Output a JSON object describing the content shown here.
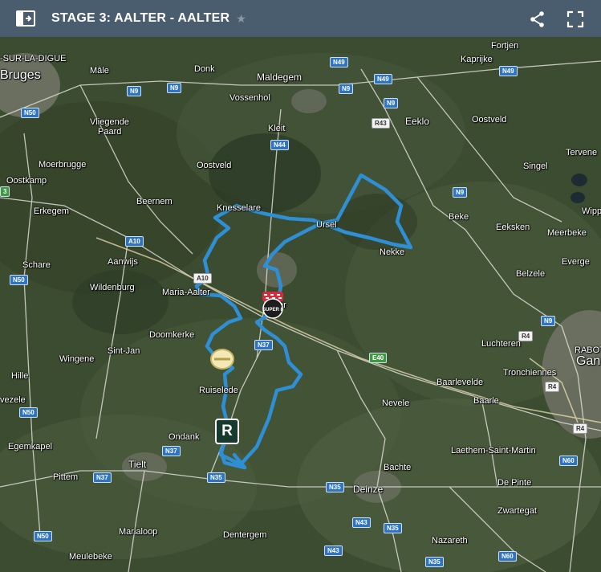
{
  "header": {
    "title": "STAGE 3: AALTER - AALTER",
    "star_icon": "star-icon",
    "share_icon": "share-icon",
    "fullscreen_icon": "fullscreen-icon",
    "panel_icon": "sidebar-toggle-icon",
    "background": "#4a5d6e"
  },
  "map": {
    "route_color": "#2f8fd4",
    "markers": {
      "start_finish_label": "R",
      "sprint_label": "SUPER 8"
    },
    "places": [
      {
        "id": "sur-la-digue",
        "name": "-SUR-LA-DIGUE"
      },
      {
        "id": "bruges",
        "name": "Bruges"
      },
      {
        "id": "male",
        "name": "Mâle"
      },
      {
        "id": "donk",
        "name": "Donk"
      },
      {
        "id": "maldegem",
        "name": "Maldegem"
      },
      {
        "id": "fortjen",
        "name": "Fortjen"
      },
      {
        "id": "kaprijke",
        "name": "Kaprijke"
      },
      {
        "id": "vossenhol",
        "name": "Vossenhol"
      },
      {
        "id": "vliegende-paard",
        "name": "Vliegende"
      },
      {
        "id": "vliegende-paard-2",
        "name": "Paard"
      },
      {
        "id": "kleit",
        "name": "Kleit"
      },
      {
        "id": "eeklo",
        "name": "Eeklo"
      },
      {
        "id": "oostveld-e",
        "name": "Oostveld"
      },
      {
        "id": "moerbrugge",
        "name": "Moerbrugge"
      },
      {
        "id": "oostveld-w",
        "name": "Oostveld"
      },
      {
        "id": "tervenen",
        "name": "Tervene"
      },
      {
        "id": "oostkamp",
        "name": "Oostkamp"
      },
      {
        "id": "singel",
        "name": "Singel"
      },
      {
        "id": "beernem",
        "name": "Beernem"
      },
      {
        "id": "knesselare",
        "name": "Knesselare"
      },
      {
        "id": "erkegem",
        "name": "Erkegem"
      },
      {
        "id": "ursel",
        "name": "Ursel"
      },
      {
        "id": "beke",
        "name": "Beke"
      },
      {
        "id": "wippelgem",
        "name": "Wipp"
      },
      {
        "id": "eeksken",
        "name": "Eeksken"
      },
      {
        "id": "meerbeke",
        "name": "Meerbeke"
      },
      {
        "id": "schare",
        "name": "Schare"
      },
      {
        "id": "aanwijs",
        "name": "Aanwijs"
      },
      {
        "id": "nekke",
        "name": "Nekke"
      },
      {
        "id": "evergem",
        "name": "Everge"
      },
      {
        "id": "belzele",
        "name": "Belzele"
      },
      {
        "id": "maria-aalter",
        "name": "Maria-Aalter"
      },
      {
        "id": "aalter",
        "name": "Aalter"
      },
      {
        "id": "wildenburg",
        "name": "Wildenburg"
      },
      {
        "id": "doomkerke",
        "name": "Doomkerke"
      },
      {
        "id": "luchteren",
        "name": "Luchteren"
      },
      {
        "id": "rabot",
        "name": "RABOT"
      },
      {
        "id": "wingene",
        "name": "Wingene"
      },
      {
        "id": "sint-jan",
        "name": "Sint-Jan"
      },
      {
        "id": "tronchiennes",
        "name": "Tronchiennes"
      },
      {
        "id": "gand",
        "name": "Gan"
      },
      {
        "id": "baarlevelde",
        "name": "Baarlevelde"
      },
      {
        "id": "hille",
        "name": "Hille"
      },
      {
        "id": "ruiselede",
        "name": "Ruiselede"
      },
      {
        "id": "nevele",
        "name": "Nevele"
      },
      {
        "id": "baarle",
        "name": "Baarle"
      },
      {
        "id": "zwevezele",
        "name": "vezele"
      },
      {
        "id": "egemkapel",
        "name": "Egemkapel"
      },
      {
        "id": "ondank",
        "name": "Ondank"
      },
      {
        "id": "laethem",
        "name": "Laethem-Saint-Martin"
      },
      {
        "id": "tielt",
        "name": "Tielt"
      },
      {
        "id": "bachte",
        "name": "Bachte"
      },
      {
        "id": "pittem",
        "name": "Pittem"
      },
      {
        "id": "de-pinte",
        "name": "De Pinte"
      },
      {
        "id": "deinze",
        "name": "Deinze"
      },
      {
        "id": "zwartegat",
        "name": "Zwartegat"
      },
      {
        "id": "marialoop",
        "name": "Marialoop"
      },
      {
        "id": "dentergem",
        "name": "Dentergem"
      },
      {
        "id": "nazareth",
        "name": "Nazareth"
      },
      {
        "id": "meulebeke",
        "name": "Meulebeke"
      }
    ],
    "road_shields": [
      "N49",
      "N49",
      "N49",
      "N9",
      "N9",
      "N9",
      "N9",
      "N50",
      "R43",
      "N44",
      "N9",
      "A10",
      "A10",
      "N50",
      "N9",
      "R4",
      "N37",
      "E40",
      "R4",
      "R4",
      "N50",
      "N60",
      "N37",
      "N35",
      "N35",
      "N43",
      "N35",
      "N43",
      "N35",
      "N50",
      "N60",
      "N37",
      "3",
      "RABOT"
    ]
  }
}
